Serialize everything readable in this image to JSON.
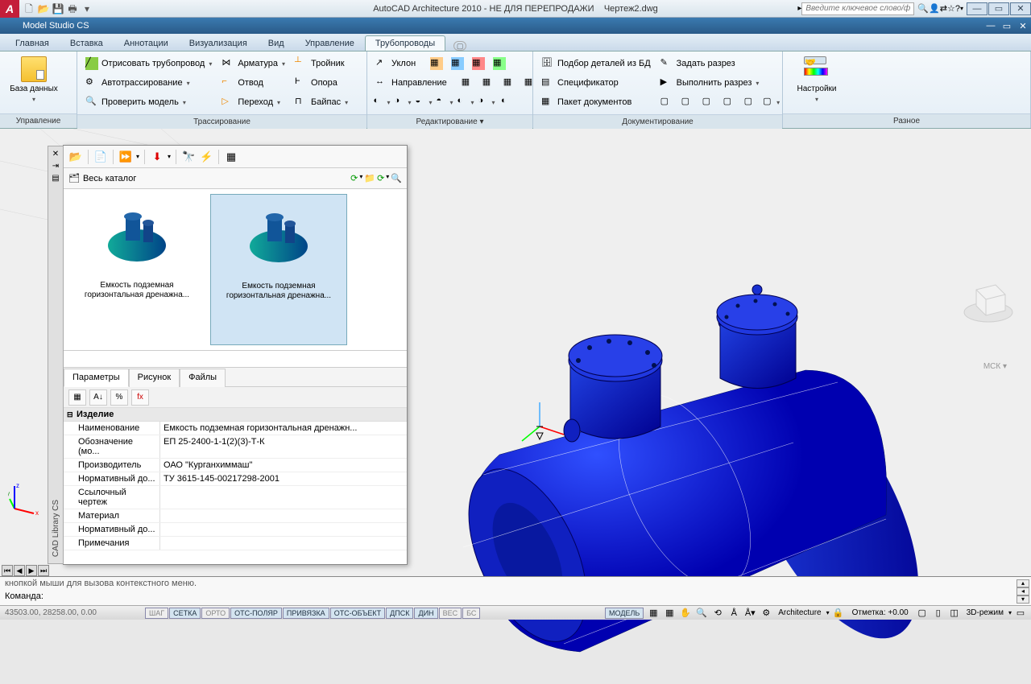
{
  "titlebar": {
    "appTitle": "AutoCAD Architecture 2010 - НЕ ДЛЯ ПЕРЕПРОДАЖИ",
    "docName": "Чертеж2.dwg",
    "searchPlaceholder": "Введите ключевое слово/фразу"
  },
  "titlebar2": "Model Studio CS",
  "ribbonTabs": [
    "Главная",
    "Вставка",
    "Аннотации",
    "Визуализация",
    "Вид",
    "Управление",
    "Трубопроводы"
  ],
  "activeTab": 6,
  "panels": {
    "p0": {
      "label": "Управление",
      "bigbtn": "База данных"
    },
    "p1": {
      "label": "Трассирование",
      "c1": [
        "Отрисовать трубопровод",
        "Автотрассирование",
        "Проверить модель"
      ],
      "c2": [
        "Арматура",
        "Отвод",
        "Переход"
      ],
      "c3": [
        "Тройник",
        "Опора",
        "Байпас"
      ]
    },
    "p2": {
      "label": "Редактирование ▾",
      "items": [
        "Уклон",
        "Направление"
      ]
    },
    "p3": {
      "label": "Документирование",
      "items": [
        "Подбор деталей из БД",
        "Спецификатор",
        "Пакет документов",
        "Задать разрез",
        "Выполнить разрез"
      ]
    },
    "p4": {
      "label": "Разное",
      "bigbtn": "Настройки"
    }
  },
  "palette": {
    "sideTitle": "CAD Library CS",
    "catalog": "Весь каталог",
    "thumbs": [
      "Емкость подземная горизонтальная дренажна...",
      "Емкость подземная горизонтальная дренажна..."
    ],
    "tabs": [
      "Параметры",
      "Рисунок",
      "Файлы"
    ],
    "group": "Изделие",
    "props": [
      {
        "k": "Наименование",
        "v": "Емкость подземная горизонтальная дренажн..."
      },
      {
        "k": "Обозначение (мо...",
        "v": "ЕП 25-2400-1-1(2)(3)-Т-К"
      },
      {
        "k": "Производитель",
        "v": "ОАО \"Курганхиммаш\""
      },
      {
        "k": "Нормативный до...",
        "v": "ТУ 3615-145-00217298-2001"
      },
      {
        "k": "Ссылочный чертеж",
        "v": ""
      },
      {
        "k": "Материал",
        "v": ""
      },
      {
        "k": "Нормативный до...",
        "v": ""
      },
      {
        "k": "Примечания",
        "v": ""
      }
    ]
  },
  "viewcube": {
    "label": "МСК ▾"
  },
  "cmd": {
    "history": "кнопкой мыши для вызова контекстного меню.",
    "prompt": "Команда:"
  },
  "status": {
    "coords": "43503.00, 28258.00, 0.00",
    "toggles": [
      "ШАГ",
      "СЕТКА",
      "ОРТО",
      "ОТС-ПОЛЯР",
      "ПРИВЯЗКА",
      "ОТС-ОБЪЕКТ",
      "ДПСК",
      "ДИН",
      "ВЕС",
      "БС"
    ],
    "model": "МОДЕЛЬ",
    "ws": "Architecture",
    "elev": "Отметка: +0.00",
    "mode3d": "3D-режим"
  }
}
